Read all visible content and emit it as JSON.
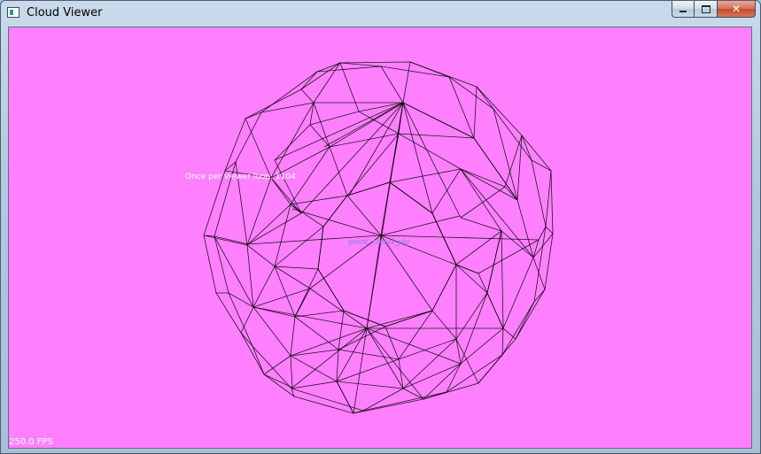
{
  "window": {
    "title": "Cloud Viewer",
    "controls": {
      "minimize": "minimize",
      "maximize": "maximize",
      "close": "✕"
    }
  },
  "viewer": {
    "background_color": "#ff80ff",
    "mesh_color": "#000000",
    "loop_text": "Once per viewer loop: 1104",
    "center_label": "point_cloud_ply",
    "fps_text": "250.0 FPS"
  }
}
